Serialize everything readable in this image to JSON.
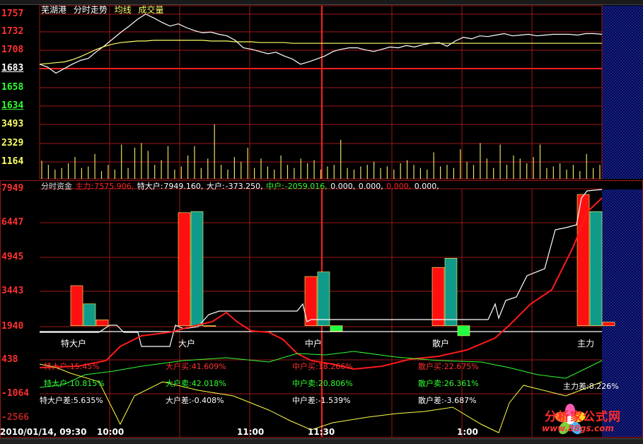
{
  "title_bar": {
    "stock": "芜湖港",
    "items": [
      "分时走势",
      "均线",
      "成交量"
    ]
  },
  "price_panel": {
    "ylabels": [
      "1757",
      "1732",
      "1708",
      "1683",
      "1658",
      "1634"
    ],
    "ylabel_colors": [
      "#ff3030",
      "#ff3030",
      "#ff3030",
      "#ffffff",
      "#30ff30",
      "#30ff30"
    ],
    "reference_price": "1683"
  },
  "volume_panel": {
    "ylabels": [
      "3493",
      "2329",
      "1164"
    ]
  },
  "flow_panel": {
    "legend_title": "分时资金",
    "legend": [
      {
        "label": "主力:",
        "value": "7575.906,",
        "color": "#ff2020"
      },
      {
        "label": "特大户:",
        "value": "7949.160,",
        "color": "#ffffff"
      },
      {
        "label": "大户:",
        "value": "-373.250,",
        "color": "#ffffff"
      },
      {
        "label": "中户:",
        "value": "-2059.016,",
        "color": "#30ff30"
      },
      {
        "label": "",
        "value": "0.000,",
        "color": "#ffffff"
      },
      {
        "label": "",
        "value": "0.000,",
        "color": "#ffffff"
      },
      {
        "label": "",
        "value": "0.000,",
        "color": "#ff2020"
      },
      {
        "label": "",
        "value": "0.000,",
        "color": "#ffffff"
      }
    ],
    "ylabels": [
      "7949",
      "6447",
      "4945",
      "3443",
      "1940",
      "438",
      "-1064",
      "-2566"
    ],
    "categories": [
      "特大户",
      "大户",
      "中户",
      "散户",
      "主力"
    ]
  },
  "stats": {
    "buy": [
      {
        "text": "特大户:15.45%",
        "color": "#ff3030"
      },
      {
        "text": "大户买:41.609%",
        "color": "#ff3030"
      },
      {
        "text": "中户买:18.266%",
        "color": "#ff3030"
      },
      {
        "text": "散户买:22.675%",
        "color": "#ff3030"
      }
    ],
    "sell": [
      {
        "text": "特大户:10.815%",
        "color": "#30ff30"
      },
      {
        "text": "大户卖:42.018%",
        "color": "#30ff30"
      },
      {
        "text": "中户卖:20.806%",
        "color": "#30ff30"
      },
      {
        "text": "散户卖:26.361%",
        "color": "#30ff30"
      },
      {
        "text": "主力差:8.226%",
        "color": "#ffffff"
      }
    ],
    "diff": [
      {
        "text": "特大户差:5.635%",
        "color": "#ffffff"
      },
      {
        "text": "大户差:-0.408%",
        "color": "#ffffff"
      },
      {
        "text": "中户差:-1.539%",
        "color": "#ffffff"
      },
      {
        "text": "散户差:-3.687%",
        "color": "#ffffff"
      }
    ]
  },
  "time_axis": {
    "labels": [
      "2010/01/14, 09:30",
      "10:00",
      "11:00",
      "11:30",
      "1:00"
    ]
  },
  "logo": {
    "name": "分析家公式网",
    "url": "www.88gs.com"
  },
  "colors": {
    "grid": "#a01818",
    "price": "#ffffff",
    "avg": "#ffff66",
    "volume": "#e8e060",
    "bar_red": "#ff1010",
    "bar_teal": "#109a8a",
    "bar_green": "#20ff40"
  },
  "chart_data": [
    {
      "type": "line",
      "title": "",
      "series": [
        {
          "name": "分时走势",
          "values": [
            1690,
            1686,
            1678,
            1684,
            1690,
            1695,
            1698,
            1707,
            1715,
            1724,
            1733,
            1741,
            1750,
            1757,
            1752,
            1746,
            1741,
            1744,
            1739,
            1735,
            1732,
            1733,
            1730,
            1728,
            1722,
            1712,
            1710,
            1707,
            1704,
            1706,
            1701,
            1697,
            1690,
            1693,
            1697,
            1701,
            1707,
            1710,
            1712,
            1712,
            1709,
            1707,
            1710,
            1713,
            1712,
            1715,
            1713,
            1716,
            1718,
            1719,
            1714,
            1721,
            1726,
            1724,
            1728,
            1727,
            1729,
            1731,
            1728,
            1729,
            1730,
            1728,
            1729,
            1730,
            1730,
            1730,
            1729,
            1731,
            1731,
            1730
          ]
        },
        {
          "name": "均线",
          "values": [
            1690,
            1691,
            1692,
            1693,
            1696,
            1700,
            1705,
            1710,
            1714,
            1717,
            1719,
            1720,
            1721,
            1721,
            1722,
            1722,
            1722,
            1722,
            1722,
            1722,
            1722,
            1721,
            1721,
            1721,
            1720,
            1720,
            1720,
            1719,
            1719,
            1719,
            1719,
            1718,
            1718,
            1718,
            1718,
            1718,
            1718,
            1718,
            1718,
            1718,
            1718,
            1718,
            1718,
            1718,
            1718,
            1718,
            1718,
            1718,
            1718,
            1718,
            1718,
            1718,
            1718,
            1718,
            1718,
            1718,
            1718,
            1718,
            1718,
            1718,
            1718,
            1718,
            1718,
            1718,
            1718,
            1718,
            1718,
            1718,
            1718,
            1718
          ]
        }
      ],
      "ylim": [
        1634,
        1757
      ]
    },
    {
      "type": "bar",
      "title": "",
      "ylabel": "成交量",
      "values": [
        1164,
        900,
        600,
        700,
        1000,
        1400,
        700,
        800,
        1600,
        500,
        900,
        600,
        2200,
        700,
        2000,
        2300,
        1800,
        900,
        1200,
        2100,
        600,
        800,
        1500,
        2100,
        700,
        1300,
        3493,
        900,
        600,
        1400,
        1100,
        2000,
        700,
        1300,
        800,
        600,
        1500,
        900,
        700,
        1300,
        1000,
        1200,
        600,
        800,
        900,
        2500,
        700,
        600,
        800,
        900,
        1100,
        700,
        800,
        600,
        1000,
        1200,
        900,
        700,
        600,
        1700,
        800,
        900,
        700,
        1900,
        1100,
        900,
        2300,
        1300,
        700,
        2200,
        900,
        1500,
        1300,
        1000,
        1400,
        2200,
        700,
        800,
        1000,
        600,
        900,
        500,
        1600,
        700,
        900
      ],
      "ylim": [
        0,
        3493
      ]
    },
    {
      "type": "bar",
      "title": "分时资金",
      "categories": [
        "特大户",
        "大户",
        "中户",
        "散户",
        "主力"
      ],
      "series": [
        {
          "name": "买",
          "values": [
            3700,
            6900,
            4100,
            4500,
            7700
          ]
        },
        {
          "name": "卖",
          "values": [
            2900,
            6950,
            4300,
            4900,
            6950
          ]
        },
        {
          "name": "差",
          "values": [
            2200,
            1940,
            1700,
            1500,
            2100
          ]
        }
      ],
      "baseline": 1940,
      "ylim": [
        -2566,
        7949
      ]
    }
  ]
}
